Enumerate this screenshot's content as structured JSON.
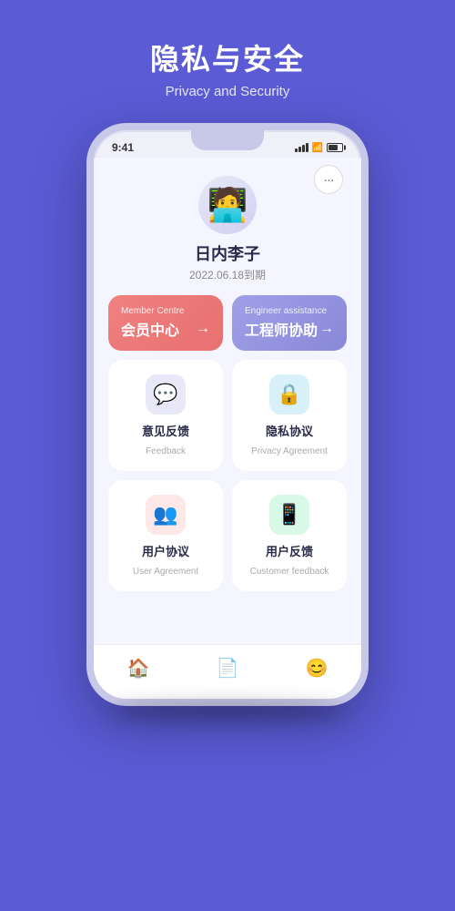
{
  "header": {
    "title": "隐私与安全",
    "subtitle": "Privacy and Security"
  },
  "statusBar": {
    "time": "9:41"
  },
  "moreButton": {
    "label": "···"
  },
  "avatar": {
    "emoji": "🧑‍💻"
  },
  "user": {
    "name": "日内李子",
    "expiry": "2022.06.18到期"
  },
  "actionCards": [
    {
      "smallLabel": "Member Centre",
      "mainLabel": "会员中心",
      "arrow": "→"
    },
    {
      "smallLabel": "Engineer assistance",
      "mainLabel": "工程师协助",
      "arrow": "→"
    }
  ],
  "gridCards": [
    {
      "iconName": "feedback-icon",
      "iconSymbol": "💬",
      "labelCn": "意见反馈",
      "labelEn": "Feedback",
      "iconClass": "icon-feedback"
    },
    {
      "iconName": "privacy-icon",
      "iconSymbol": "🔒",
      "labelCn": "隐私协议",
      "labelEn": "Privacy Agreement",
      "iconClass": "icon-privacy"
    },
    {
      "iconName": "user-agreement-icon",
      "iconSymbol": "👥",
      "labelCn": "用户协议",
      "labelEn": "User Agreement",
      "iconClass": "icon-user-agreement"
    },
    {
      "iconName": "customer-feedback-icon",
      "iconSymbol": "📱",
      "labelCn": "用户反馈",
      "labelEn": "Customer feedback",
      "iconClass": "icon-customer"
    }
  ],
  "bottomNav": [
    {
      "icon": "🏠",
      "active": false,
      "name": "home"
    },
    {
      "icon": "📄",
      "active": false,
      "name": "document"
    },
    {
      "icon": "😊",
      "active": true,
      "name": "profile"
    }
  ]
}
